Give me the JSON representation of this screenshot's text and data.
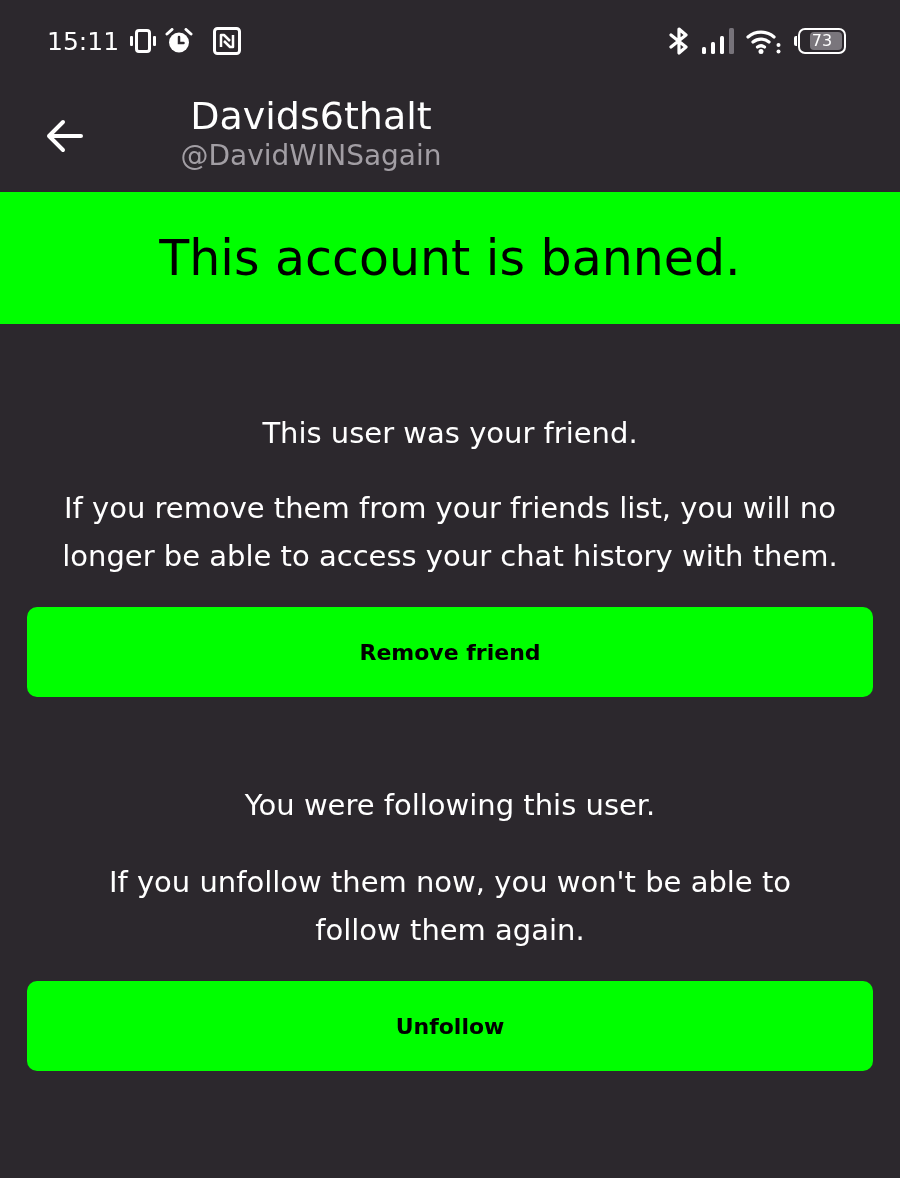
{
  "status_bar": {
    "time": "15:11",
    "battery": "73"
  },
  "header": {
    "title": "Davids6thalt",
    "handle": "@DavidWINSagain"
  },
  "banner": {
    "text": "This account is banned."
  },
  "sections": [
    {
      "heading": "This user was your friend.",
      "body": "If you remove them from your friends list, you will no longer be able to access your chat history with them.",
      "button": "Remove friend"
    },
    {
      "heading": "You were following this user.",
      "body": "If you unfollow them now, you won't be able to follow them again.",
      "button": "Unfollow"
    }
  ]
}
